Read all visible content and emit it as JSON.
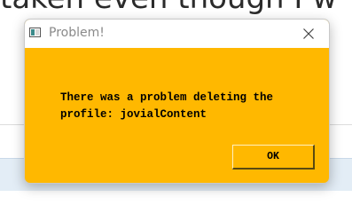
{
  "background": {
    "partial_text": "taken even though I w"
  },
  "dialog": {
    "title": "Problem!",
    "app_icon": "window-app-icon",
    "close_icon": "close-icon",
    "message": "There was a problem deleting the\nprofile: jovialContent",
    "ok_label": "OK",
    "colors": {
      "body": "#ffb800",
      "titlebar": "#ffffff",
      "text": "#000000"
    }
  }
}
